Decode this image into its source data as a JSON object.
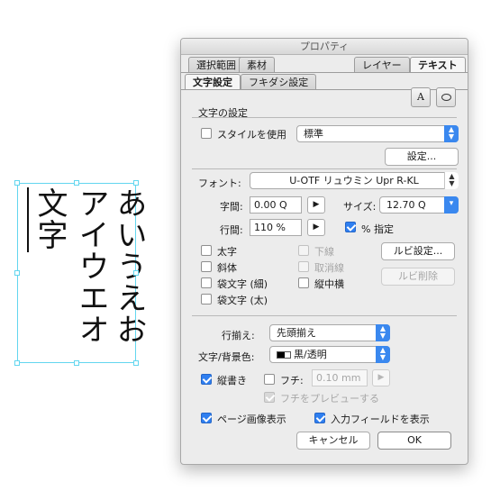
{
  "canvas": {
    "col1": "あいうえお",
    "col2": "アイウエオ",
    "col3": "文字"
  },
  "dialog": {
    "title": "プロパティ",
    "tabs_top": [
      "選択範囲",
      "素材",
      "レイヤー",
      "テキスト"
    ],
    "tabs_sub": [
      "文字設定",
      "フキダシ設定"
    ],
    "icon_a": "A",
    "section_title": "文字の設定",
    "style_checkbox": "スタイルを使用",
    "style_value": "標準",
    "settings_button": "設定...",
    "font_label": "フォント:",
    "font_value": "U-OTF リュウミン Upr R-KL",
    "char_spacing_label": "字間:",
    "char_spacing_value": "0.00 Q",
    "size_label": "サイズ:",
    "size_value": "12.70 Q",
    "line_spacing_label": "行間:",
    "line_spacing_value": "110 %",
    "percent_label": "% 指定",
    "bold": "太字",
    "italic": "斜体",
    "bag_thin": "袋文字 (細)",
    "bag_thick": "袋文字 (太)",
    "underline": "下線",
    "strike": "取消線",
    "tatechuyoko": "縦中横",
    "ruby_settings": "ルビ設定...",
    "ruby_delete": "ルビ削除",
    "align_label": "行揃え:",
    "align_value": "先頭揃え",
    "color_label": "文字/背景色:",
    "color_value": "黒/透明",
    "vertical_label": "縦書き",
    "edge_label": "フチ:",
    "edge_value": "0.10 mm",
    "edge_preview": "フチをプレビューする",
    "page_image": "ページ画像表示",
    "show_input": "入力フィールドを表示",
    "cancel": "キャンセル",
    "ok": "OK",
    "accent_color": "#2f7ff0"
  }
}
